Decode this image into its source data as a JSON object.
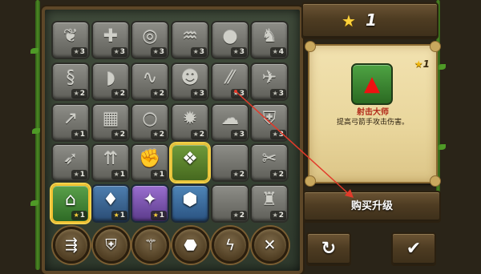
{
  "header": {
    "stars": "1",
    "star_icon": "star-icon"
  },
  "grid": {
    "rows": [
      [
        {
          "icon": "tree-icon",
          "glyph": "❦",
          "cost": "3"
        },
        {
          "icon": "figures-plus-icon",
          "glyph": "✚",
          "cost": "3"
        },
        {
          "icon": "whirlwind-icon",
          "glyph": "◎",
          "cost": "3"
        },
        {
          "icon": "sheep-icon",
          "glyph": "♒",
          "cost": "3"
        },
        {
          "icon": "bomb-icon",
          "glyph": "●",
          "cost": "3"
        },
        {
          "icon": "wolf-icon",
          "glyph": "♞",
          "cost": "4"
        }
      ],
      [
        {
          "icon": "dragon-icon",
          "glyph": "§",
          "cost": "2"
        },
        {
          "icon": "feather-blade-icon",
          "glyph": "◗",
          "cost": "2"
        },
        {
          "icon": "vine-icon",
          "glyph": "∿",
          "cost": "2"
        },
        {
          "icon": "golem-face-icon",
          "glyph": "☻",
          "cost": "3"
        },
        {
          "icon": "rain-icon",
          "glyph": "⁄⁄",
          "cost": "3"
        },
        {
          "icon": "bird-icon",
          "glyph": "✈",
          "cost": "3"
        }
      ],
      [
        {
          "icon": "spears-icon",
          "glyph": "↗",
          "cost": "1"
        },
        {
          "icon": "shield-wall-icon",
          "glyph": "▦",
          "cost": "2"
        },
        {
          "icon": "orb-icon",
          "glyph": "○",
          "cost": "2"
        },
        {
          "icon": "gear-icon",
          "glyph": "✹",
          "cost": "2"
        },
        {
          "icon": "cloud-icon",
          "glyph": "☁",
          "cost": "3"
        },
        {
          "icon": "shield-icon",
          "glyph": "⛨",
          "cost": "3"
        }
      ],
      [
        {
          "icon": "archer-icon",
          "glyph": "➶",
          "cost": "1"
        },
        {
          "icon": "arrows-plus-icon",
          "glyph": "⇈",
          "cost": "1"
        },
        {
          "icon": "hand-stone-icon",
          "glyph": "✊",
          "cost": "1"
        },
        {
          "icon": "crystal-cluster-icon",
          "glyph": "❖",
          "cost": "",
          "state": "crystal-slot"
        },
        {
          "icon": "empty-icon",
          "glyph": "",
          "cost": "2"
        },
        {
          "icon": "daggers-icon",
          "glyph": "✂",
          "cost": "2"
        }
      ],
      [
        {
          "icon": "green-hat-icon",
          "glyph": "⌂",
          "cost": "1",
          "state": "hat-slot"
        },
        {
          "icon": "gold-spikes-icon",
          "glyph": "♦",
          "cost": "1",
          "state": "gold-slot"
        },
        {
          "icon": "purple-crystal-icon",
          "glyph": "✦",
          "cost": "1",
          "state": "purple-slot"
        },
        {
          "icon": "rock-icon",
          "glyph": "⬢",
          "cost": "",
          "state": "rock-slot"
        },
        {
          "icon": "empty-icon",
          "glyph": "",
          "cost": "2"
        },
        {
          "icon": "viking-helm-icon",
          "glyph": "♜",
          "cost": "2"
        }
      ]
    ],
    "tree_icons": [
      "arrows-tree-icon",
      "shield-tree-icon",
      "mage-staff-tree-icon",
      "rock-tree-icon",
      "lightning-tree-icon",
      "crossed-swords-tree-icon"
    ],
    "tree_glyphs": [
      "⇶",
      "⛨",
      "⚚",
      "⬣",
      "ϟ",
      "✕"
    ]
  },
  "detail": {
    "icon": "green-hat-icon",
    "cost": "1",
    "name": "射击大师",
    "description": "提高弓箭手攻击伤害。"
  },
  "actions": {
    "buy_label": "购买升级",
    "reset_icon": "undo-icon",
    "reset_glyph": "↻",
    "done_icon": "checkmark-icon",
    "done_glyph": "✔"
  },
  "colors": {
    "accent_star": "#ffd23a",
    "name_red": "#b22a1a",
    "arrow_red": "#e23a2a"
  }
}
